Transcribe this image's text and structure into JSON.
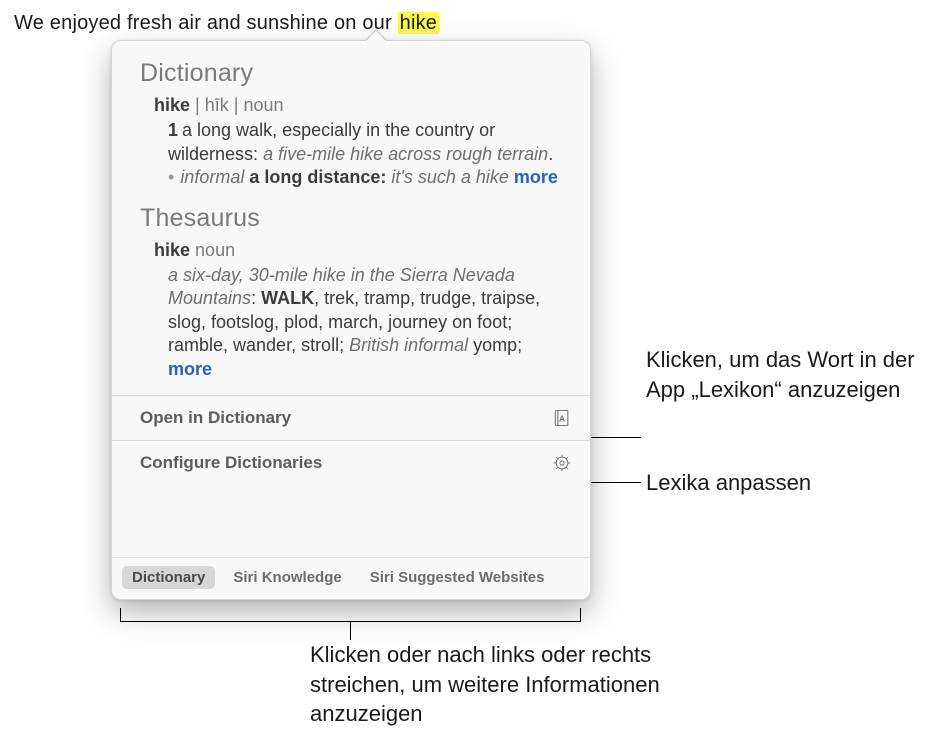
{
  "sentence": {
    "prefix": "We enjoyed fresh air and sunshine on our ",
    "highlighted": "hike"
  },
  "popover": {
    "dictionary": {
      "title": "Dictionary",
      "headword": "hike",
      "pronunciation": "hīk",
      "part_of_speech": "noun",
      "sense_number": "1",
      "definition": "a long walk, especially in the country or wilderness:",
      "example": "a five-mile hike across rough terrain",
      "sub_label": "informal",
      "sub_def": "a long distance:",
      "sub_example": "it's such a hike",
      "more": "more"
    },
    "thesaurus": {
      "title": "Thesaurus",
      "headword": "hike",
      "part_of_speech": "noun",
      "example": "a six-day, 30-mile hike in the Sierra Nevada Mountains",
      "primary": "WALK",
      "synonyms": ", trek, tramp, trudge, traipse, slog, footslog, plod, march, journey on foot; ramble, wander, stroll; ",
      "regional_label": "British informal",
      "regional_syn": " yomp; ",
      "more": "more"
    },
    "actions": {
      "open": "Open in Dictionary",
      "configure": "Configure Dictionaries"
    },
    "tabs": {
      "dictionary": "Dictionary",
      "siri_knowledge": "Siri Knowledge",
      "siri_websites": "Siri Suggested Websites"
    }
  },
  "callouts": {
    "open_app": "Klicken, um das Wort in der App „Lexikon“ anzuzeigen",
    "configure": "Lexika anpassen",
    "tabs": "Klicken oder nach links oder rechts streichen, um weitere Informationen anzuzeigen"
  }
}
